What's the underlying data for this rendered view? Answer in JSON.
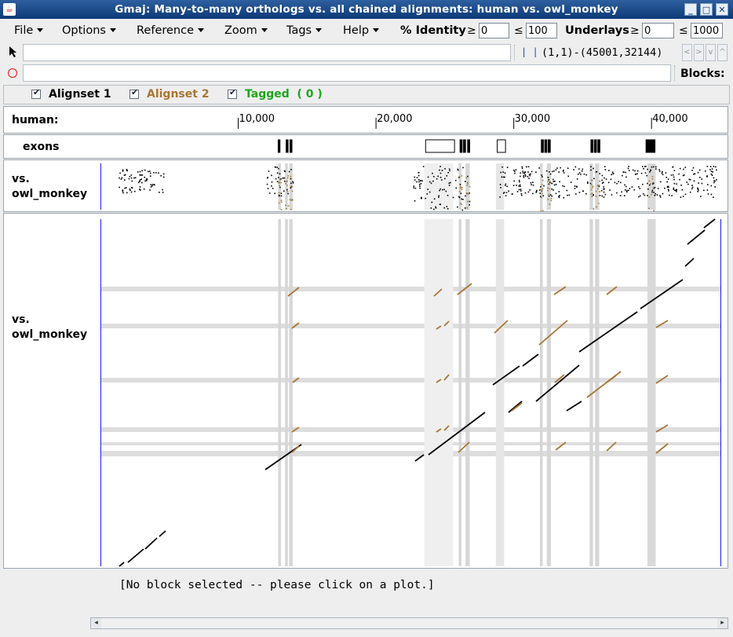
{
  "window": {
    "title": "Gmaj: Many-to-many orthologs vs. all chained alignments: human vs. owl_monkey"
  },
  "menu": {
    "items": [
      "File",
      "Options",
      "Reference",
      "Zoom",
      "Tags",
      "Help"
    ]
  },
  "filters": {
    "identity_label": "% Identity",
    "identity_ge_symbol": "≥",
    "identity_min": "0",
    "identity_le_symbol": "≤",
    "identity_max": "100",
    "underlays_label": "Underlays",
    "underlays_ge_symbol": "≥",
    "underlays_min": "0",
    "underlays_le_symbol": "≤",
    "underlays_max": "1000"
  },
  "toolbar": {
    "bars_glyph": "| |",
    "coords": "(1,1)-(45001,32144)",
    "blocks_label": "Blocks:",
    "nav_glyphs": [
      "<",
      ">",
      "v",
      "^"
    ]
  },
  "alignsets": [
    {
      "label": "Alignset 1",
      "checked": true,
      "color": "#000000"
    },
    {
      "label": "Alignset 2",
      "checked": true,
      "color": "#a87634"
    },
    {
      "label": "Tagged  ( 0 )",
      "checked": true,
      "color": "#1ea51e"
    }
  ],
  "ruler": {
    "species": "human:",
    "ticks": [
      {
        "label": "10,000",
        "value": 10000
      },
      {
        "label": "20,000",
        "value": 20000
      },
      {
        "label": "30,000",
        "value": 30000
      },
      {
        "label": "40,000",
        "value": 40000
      }
    ]
  },
  "exons": {
    "label": "exons",
    "blocks": [
      {
        "start": 12900,
        "end": 13030,
        "filled": true
      },
      {
        "start": 13480,
        "end": 13620,
        "filled": true
      },
      {
        "start": 13760,
        "end": 13900,
        "filled": true
      },
      {
        "start": 23600,
        "end": 25700,
        "filled": false
      },
      {
        "start": 26100,
        "end": 26250,
        "filled": true
      },
      {
        "start": 26350,
        "end": 26500,
        "filled": true
      },
      {
        "start": 26650,
        "end": 26800,
        "filled": true
      },
      {
        "start": 28800,
        "end": 29400,
        "filled": false
      },
      {
        "start": 32000,
        "end": 32150,
        "filled": true
      },
      {
        "start": 32250,
        "end": 32400,
        "filled": true
      },
      {
        "start": 32500,
        "end": 32650,
        "filled": true
      },
      {
        "start": 35600,
        "end": 35750,
        "filled": true
      },
      {
        "start": 35850,
        "end": 36000,
        "filled": true
      },
      {
        "start": 36100,
        "end": 36250,
        "filled": true
      },
      {
        "start": 39600,
        "end": 40250,
        "filled": true
      }
    ]
  },
  "pip": {
    "label_line1": "vs.",
    "label_line2": "owl_monkey"
  },
  "dotplot": {
    "label_line1": "vs.",
    "label_line2": "owl_monkey"
  },
  "status": {
    "message": "[No block selected -- please click on a plot.]"
  },
  "scroll": {
    "left_glyph": "◂",
    "right_glyph": "▸"
  }
}
